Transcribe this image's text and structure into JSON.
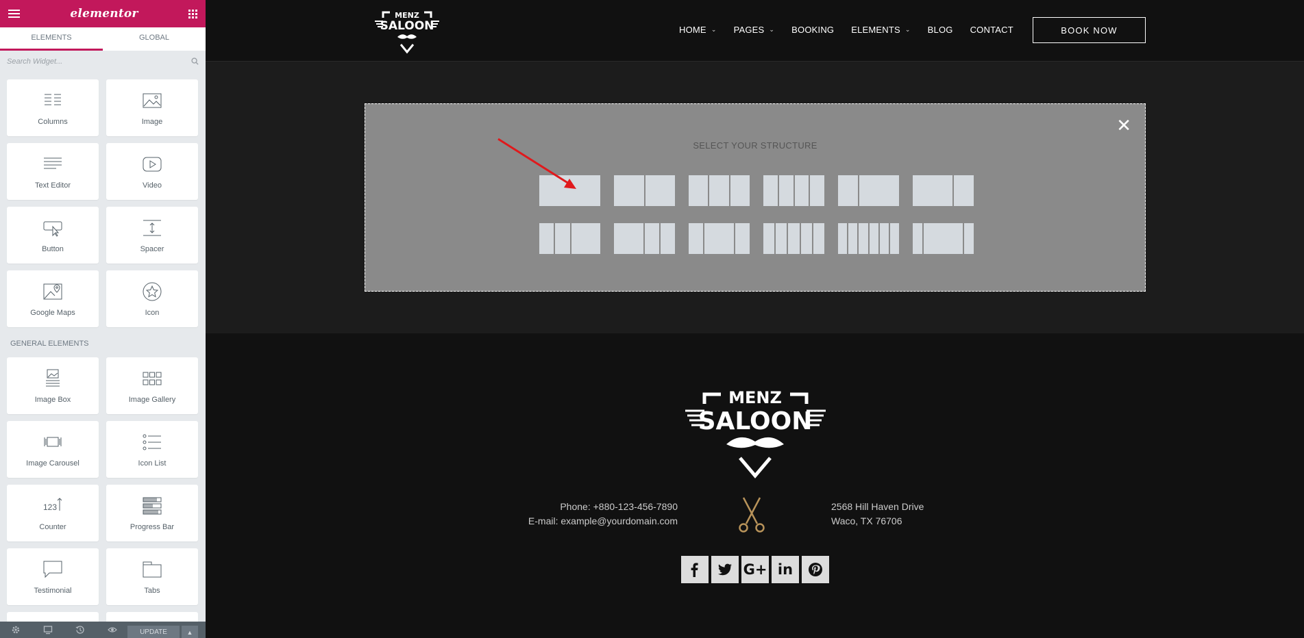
{
  "panel": {
    "brand": "elementor",
    "tabs": [
      {
        "label": "ELEMENTS"
      },
      {
        "label": "GLOBAL"
      }
    ],
    "search_placeholder": "Search Widget...",
    "basic_widgets": [
      {
        "label": "Columns",
        "icon": "columns-icon"
      },
      {
        "label": "Image",
        "icon": "image-icon"
      },
      {
        "label": "Text Editor",
        "icon": "text-editor-icon"
      },
      {
        "label": "Video",
        "icon": "video-icon"
      },
      {
        "label": "Button",
        "icon": "button-icon"
      },
      {
        "label": "Spacer",
        "icon": "spacer-icon"
      },
      {
        "label": "Google Maps",
        "icon": "google-maps-icon"
      },
      {
        "label": "Icon",
        "icon": "star-icon"
      }
    ],
    "general_title": "GENERAL ELEMENTS",
    "general_widgets": [
      {
        "label": "Image Box",
        "icon": "image-box-icon"
      },
      {
        "label": "Image Gallery",
        "icon": "image-gallery-icon"
      },
      {
        "label": "Image Carousel",
        "icon": "image-carousel-icon"
      },
      {
        "label": "Icon List",
        "icon": "icon-list-icon"
      },
      {
        "label": "Counter",
        "icon": "counter-icon"
      },
      {
        "label": "Progress Bar",
        "icon": "progress-bar-icon"
      },
      {
        "label": "Testimonial",
        "icon": "testimonial-icon"
      },
      {
        "label": "Tabs",
        "icon": "tabs-icon"
      }
    ],
    "update_label": "UPDATE",
    "accent_color": "#c2185b"
  },
  "site": {
    "nav": [
      {
        "label": "HOME",
        "dropdown": true
      },
      {
        "label": "PAGES",
        "dropdown": true
      },
      {
        "label": "BOOKING",
        "dropdown": false
      },
      {
        "label": "ELEMENTS",
        "dropdown": true
      },
      {
        "label": "BLOG",
        "dropdown": false
      },
      {
        "label": "CONTACT",
        "dropdown": false
      }
    ],
    "book_now": "BOOK NOW",
    "structure": {
      "title": "SELECT YOUR STRUCTURE",
      "close": "✕",
      "row1": [
        [
          1
        ],
        [
          1,
          1
        ],
        [
          1,
          1,
          1
        ],
        [
          1,
          1,
          1,
          1
        ],
        [
          1,
          2
        ],
        [
          2,
          1
        ]
      ],
      "row2": [
        [
          1,
          1,
          2
        ],
        [
          2,
          1,
          1
        ],
        [
          1,
          2,
          1
        ],
        [
          1,
          1,
          1,
          1,
          1
        ],
        [
          1,
          1,
          1,
          1,
          1,
          1
        ],
        [
          1,
          4,
          1
        ]
      ]
    },
    "logo": {
      "top": "MENZ",
      "main": "SALOON"
    },
    "contact_left": {
      "phone": "Phone: +880-123-456-7890",
      "email": "E-mail: example@yourdomain.com"
    },
    "contact_right": {
      "street": "2568 Hill Haven Drive",
      "city": "Waco, TX 76706"
    },
    "socials": [
      {
        "icon": "facebook-icon",
        "glyph": "f"
      },
      {
        "icon": "twitter-icon",
        "glyph": "t"
      },
      {
        "icon": "google-plus-icon",
        "glyph": "G+"
      },
      {
        "icon": "linkedin-icon",
        "glyph": "in"
      },
      {
        "icon": "pinterest-icon",
        "glyph": "P"
      }
    ],
    "scissors_color": "#b8935a"
  }
}
